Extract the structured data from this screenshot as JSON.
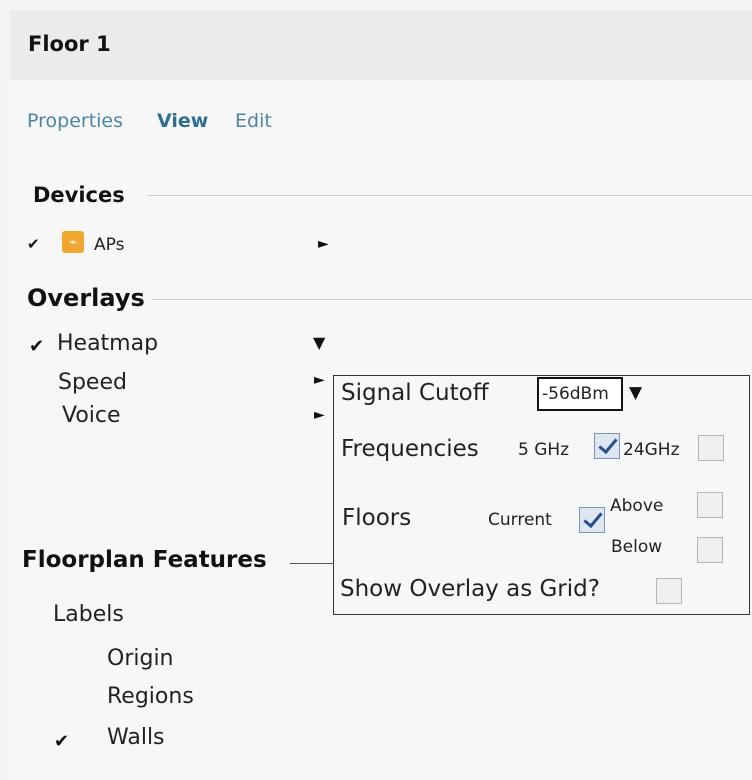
{
  "header": {
    "title": "Floor 1"
  },
  "tabs": [
    {
      "label": "Properties",
      "active": false
    },
    {
      "label": "View",
      "active": true
    },
    {
      "label": "Edit",
      "active": false
    }
  ],
  "devices": {
    "title": "Devices",
    "items": [
      {
        "label": "APs",
        "checked": true,
        "icon": "ap-icon"
      }
    ]
  },
  "overlays": {
    "title": "Overlays",
    "items": [
      {
        "label": "Heatmap",
        "checked": true,
        "expanded": true
      },
      {
        "label": "Speed",
        "checked": false
      },
      {
        "label": "Voice",
        "checked": false
      }
    ]
  },
  "heatmap_panel": {
    "signal_cutoff_label": "Signal Cutoff",
    "signal_cutoff_value": "-56dBm",
    "frequencies_label": "Frequencies",
    "freq_5ghz_label": "5 GHz",
    "freq_5ghz_checked": true,
    "freq_24ghz_label": "24GHz",
    "freq_24ghz_checked": false,
    "floors_label": "Floors",
    "current_label": "Current",
    "current_checked": true,
    "above_label": "Above",
    "above_checked": false,
    "below_label": "Below",
    "below_checked": false,
    "grid_label": "Show Overlay as Grid?",
    "grid_checked": false
  },
  "floorplan_features": {
    "title": "Floorplan Features",
    "labels_title": "Labels",
    "items": [
      {
        "label": "Origin",
        "checked": false
      },
      {
        "label": "Regions",
        "checked": false
      },
      {
        "label": "Walls",
        "checked": true
      }
    ]
  },
  "glyphs": {
    "check": "✔",
    "arrow_right": "►",
    "arrow_down": "▼"
  },
  "colors": {
    "tab_link": "#4e86a6",
    "ap_icon": "#f0a830",
    "checkbox_check": "#2b4f8c"
  }
}
